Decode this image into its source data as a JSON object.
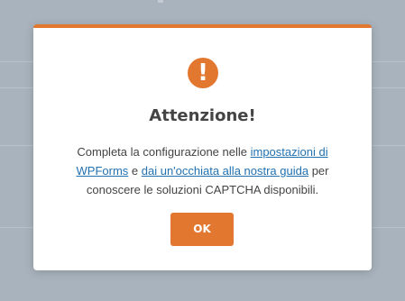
{
  "dialog": {
    "icon": "exclamation-circle-icon",
    "icon_glyph": "!",
    "title": "Attenzione!",
    "message_part1": "Completa la configurazione nelle ",
    "link1_text": "impostazioni di WPForms",
    "message_part2": " e ",
    "link2_text": "dai un'occhiata alla nostra guida",
    "message_part3": " per conoscere le soluzioni CAPTCHA disponibili.",
    "ok_label": "OK"
  },
  "colors": {
    "accent": "#e27730",
    "link": "#2271b1",
    "text": "#444444",
    "overlay": "#a9b3bd"
  }
}
